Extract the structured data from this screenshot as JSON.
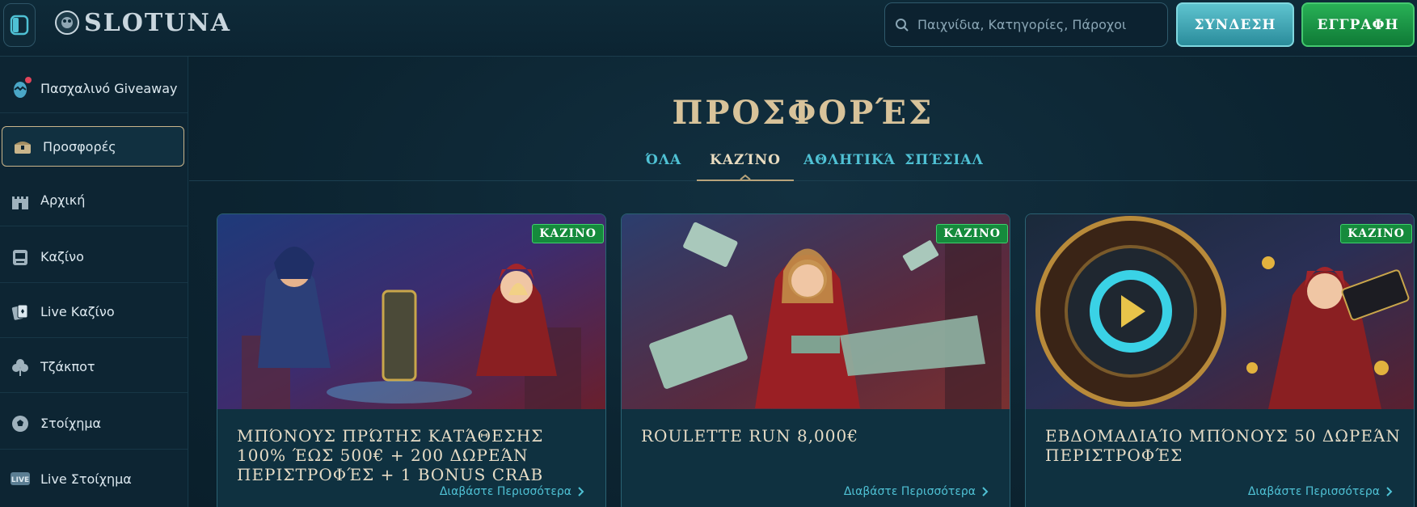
{
  "header": {
    "logo_text": "SLOTUNA",
    "search_placeholder": "Παιχνίδια, Κατηγορίες, Πάροχοι",
    "login_label": "ΣΥΝΔΕΣΗ",
    "register_label": "ΕΓΓΡΑΦΗ"
  },
  "sidebar": {
    "items": [
      {
        "label": "Πασχαλινό Giveaway",
        "icon": "egg-icon",
        "notification": true
      },
      {
        "label": "Προσφορές",
        "icon": "treasure-chest-icon",
        "active": true
      },
      {
        "label": "Αρχική",
        "icon": "castle-icon"
      },
      {
        "label": "Καζίνο",
        "icon": "slot-machine-icon"
      },
      {
        "label": "Live Καζίνο",
        "icon": "cards-icon"
      },
      {
        "label": "Τζάκποτ",
        "icon": "clover-icon"
      },
      {
        "label": "Στοίχημα",
        "icon": "football-icon"
      },
      {
        "label": "Live Στοίχημα",
        "icon": "live-icon"
      }
    ]
  },
  "main": {
    "title": "ΠΡΟΣΦΟΡΈΣ",
    "tabs": [
      {
        "label": "ΌΛΑ"
      },
      {
        "label": "ΚΑΖΊΝΟ",
        "active": true
      },
      {
        "label": "ΑΘΛΗΤΙΚΆ"
      },
      {
        "label": "ΣΠΈΣΙΑΛ"
      }
    ],
    "cards": [
      {
        "badge": "ΚΑΖΙΝΟ",
        "title": "ΜΠΌΝΟΥΣ ΠΡΏΤΗΣ ΚΑΤΆΘΕΣΗΣ 100% ΈΩΣ 500€ + 200 ΔΩΡΕΆΝ ΠΕΡΙΣΤΡΟΦΈΣ + 1 BONUS CRAB",
        "link": "Διαβάστε Περισσότερα"
      },
      {
        "badge": "ΚΑΖΙΝΟ",
        "title": "ROULETTE RUN 8,000€",
        "link": "Διαβάστε Περισσότερα"
      },
      {
        "badge": "ΚΑΖΙΝΟ",
        "title": "ΕΒΔΟΜΑΔΙΑΊΟ ΜΠΌΝΟΥΣ 50 ΔΩΡΕΆΝ ΠΕΡΙΣΤΡΟΦΈΣ",
        "link": "Διαβάστε Περισσότερα"
      }
    ]
  },
  "colors": {
    "accent_teal": "#4fc1d4",
    "gold": "#d8c39a",
    "register_green": "#158a3c",
    "login_teal": "#2a8c9b"
  }
}
